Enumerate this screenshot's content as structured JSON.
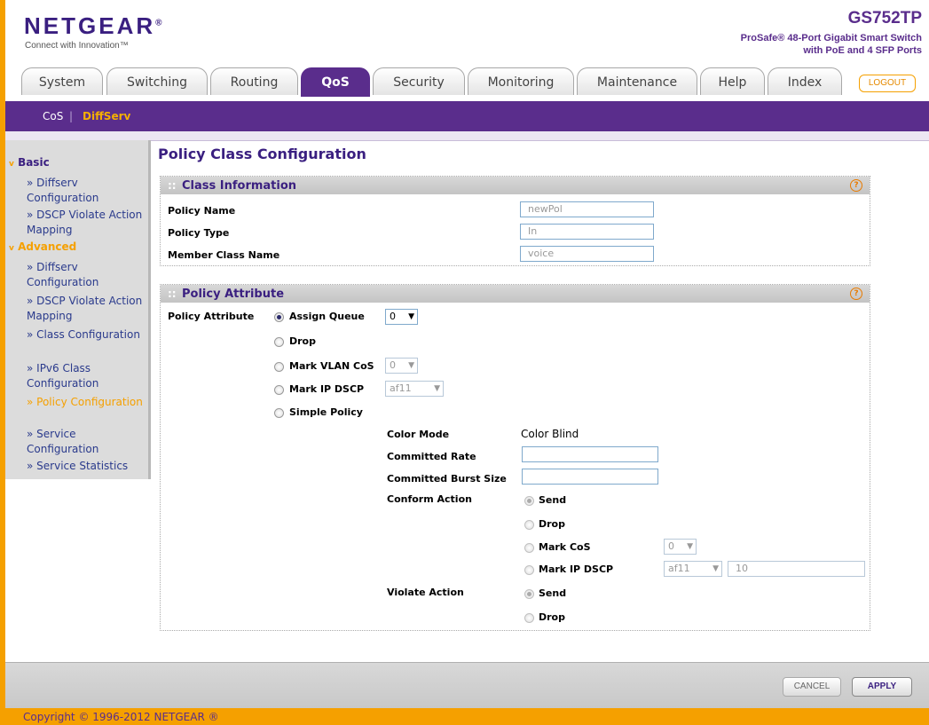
{
  "brand": {
    "logo": "NETGEAR",
    "logo_mark": "®",
    "tagline": "Connect with Innovation™",
    "model": "GS752TP",
    "model_desc_1": "ProSafe® 48-Port Gigabit Smart Switch",
    "model_desc_2": "with PoE and 4 SFP Ports"
  },
  "tabs": [
    "System",
    "Switching",
    "Routing",
    "QoS",
    "Security",
    "Monitoring",
    "Maintenance",
    "Help",
    "Index"
  ],
  "active_tab": "QoS",
  "logout_label": "LOGOUT",
  "subnav": {
    "items": [
      "CoS",
      "DiffServ"
    ],
    "separator": "|",
    "active": "DiffServ"
  },
  "sidebar": {
    "basic_label": "Basic",
    "advanced_label": "Advanced",
    "basic_items": [
      "» Diffserv Configuration",
      "» DSCP Violate Action Mapping"
    ],
    "advanced_items": [
      "» Diffserv Configuration",
      "» DSCP Violate Action Mapping",
      "» Class Configuration",
      "» IPv6 Class Configuration",
      "» Policy Configuration",
      "» Service Configuration",
      "» Service Statistics"
    ],
    "active_item": "» Policy Configuration"
  },
  "page_title": "Policy Class Configuration",
  "class_info": {
    "title": "Class Information",
    "policy_name_label": "Policy Name",
    "policy_name_value": "newPol",
    "policy_type_label": "Policy Type",
    "policy_type_value": "In",
    "member_class_label": "Member Class Name",
    "member_class_value": "voice"
  },
  "policy_attr": {
    "title": "Policy Attribute",
    "row_label": "Policy Attribute",
    "assign_queue": "Assign Queue",
    "assign_queue_value": "0",
    "drop": "Drop",
    "mark_vlan_cos": "Mark VLAN CoS",
    "mark_vlan_cos_value": "0",
    "mark_ip_dscp": "Mark IP DSCP",
    "mark_ip_dscp_value": "af11",
    "simple_policy": "Simple Policy",
    "color_mode_label": "Color Mode",
    "color_mode_value": "Color Blind",
    "committed_rate_label": "Committed Rate",
    "committed_burst_label": "Committed Burst Size",
    "conform_action_label": "Conform Action",
    "conform_send": "Send",
    "conform_drop": "Drop",
    "conform_mark_cos": "Mark CoS",
    "conform_mark_cos_value": "0",
    "conform_mark_dscp": "Mark IP DSCP",
    "conform_mark_dscp_value": "af11",
    "conform_mark_dscp_num": "10",
    "violate_action_label": "Violate Action",
    "violate_send": "Send",
    "violate_drop": "Drop"
  },
  "buttons": {
    "cancel": "CANCEL",
    "apply": "APPLY"
  },
  "copyright": "Copyright © 1996-2012 NETGEAR ®",
  "colors": {
    "brand_purple": "#5a2d8c",
    "accent_orange": "#f5a000"
  }
}
